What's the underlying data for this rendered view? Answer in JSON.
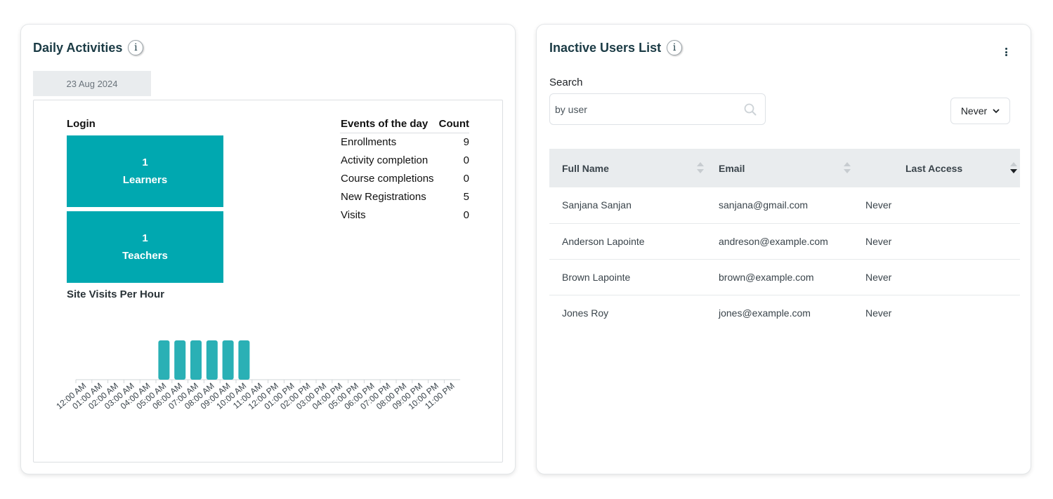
{
  "daily_activities": {
    "title": "Daily Activities",
    "date": "23 Aug 2024",
    "login_label": "Login",
    "stats": [
      {
        "value": "1",
        "label": "Learners"
      },
      {
        "value": "1",
        "label": "Teachers"
      }
    ],
    "events_header": {
      "event": "Events of the day",
      "count": "Count"
    },
    "events": [
      {
        "name": "Enrollments",
        "count": "9"
      },
      {
        "name": "Activity completion",
        "count": "0"
      },
      {
        "name": "Course completions",
        "count": "0"
      },
      {
        "name": "New Registrations",
        "count": "5"
      },
      {
        "name": "Visits",
        "count": "0"
      }
    ],
    "site_visits_label": "Site Visits Per Hour"
  },
  "chart_data": {
    "type": "bar",
    "title": "Site Visits Per Hour",
    "categories": [
      "12:00 AM",
      "01:00 AM",
      "02:00 AM",
      "03:00 AM",
      "04:00 AM",
      "05:00 AM",
      "06:00 AM",
      "07:00 AM",
      "08:00 AM",
      "09:00 AM",
      "10:00 AM",
      "11:00 AM",
      "12:00 PM",
      "01:00 PM",
      "02:00 PM",
      "03:00 PM",
      "04:00 PM",
      "05:00 PM",
      "06:00 PM",
      "07:00 PM",
      "08:00 PM",
      "09:00 PM",
      "10:00 PM",
      "11:00 PM"
    ],
    "values": [
      0,
      0,
      0,
      0,
      0,
      1,
      1,
      1,
      1,
      1,
      1,
      0,
      0,
      0,
      0,
      0,
      0,
      0,
      0,
      0,
      0,
      0,
      0,
      0
    ],
    "ylim": [
      0,
      1
    ],
    "color": "#2ab0b5"
  },
  "inactive_users": {
    "title": "Inactive Users List",
    "search_label": "Search",
    "search_placeholder": "by user",
    "filter_value": "Never",
    "columns": [
      "Full Name",
      "Email",
      "Last Access"
    ],
    "rows": [
      {
        "name": "Sanjana Sanjan",
        "email": "sanjana@gmail.com",
        "last_access": "Never"
      },
      {
        "name": "Anderson Lapointe",
        "email": "andreson@example.com",
        "last_access": "Never"
      },
      {
        "name": "Brown Lapointe",
        "email": "brown@example.com",
        "last_access": "Never"
      },
      {
        "name": "Jones Roy",
        "email": "jones@example.com",
        "last_access": "Never"
      }
    ]
  },
  "colors": {
    "accent": "#00a8b0",
    "title": "#1b3b45"
  }
}
